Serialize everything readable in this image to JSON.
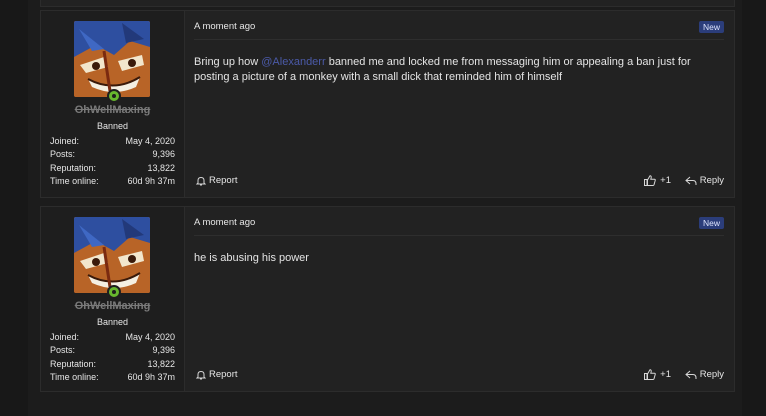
{
  "posts": [
    {
      "user": {
        "username": "OhWellMaxing",
        "role": "Banned",
        "joined_label": "Joined:",
        "joined_value": "May 4, 2020",
        "posts_label": "Posts:",
        "posts_value": "9,396",
        "reputation_label": "Reputation:",
        "reputation_value": "13,822",
        "time_online_label": "Time online:",
        "time_online_value": "60d 9h 37m"
      },
      "timestamp": "A moment ago",
      "badge": "New",
      "text_before": "Bring up how ",
      "mention": "@Alexanderr",
      "text_after": " banned me and locked me from messaging him or appealing a ban just for posting a picture of a monkey with a small dick that reminded him of himself",
      "report_label": "Report",
      "like_count": "+1",
      "reply_label": "Reply"
    },
    {
      "user": {
        "username": "OhWellMaxing",
        "role": "Banned",
        "joined_label": "Joined:",
        "joined_value": "May 4, 2020",
        "posts_label": "Posts:",
        "posts_value": "9,396",
        "reputation_label": "Reputation:",
        "reputation_value": "13,822",
        "time_online_label": "Time online:",
        "time_online_value": "60d 9h 37m"
      },
      "timestamp": "A moment ago",
      "badge": "New",
      "text": "he is abusing his power",
      "report_label": "Report",
      "like_count": "+1",
      "reply_label": "Reply"
    }
  ],
  "colors": {
    "page_bg": "#181818",
    "post_bg": "#222222",
    "badge_bg": "#2b3d7a",
    "mention": "#4b5aa8",
    "online": "#67b72e"
  }
}
